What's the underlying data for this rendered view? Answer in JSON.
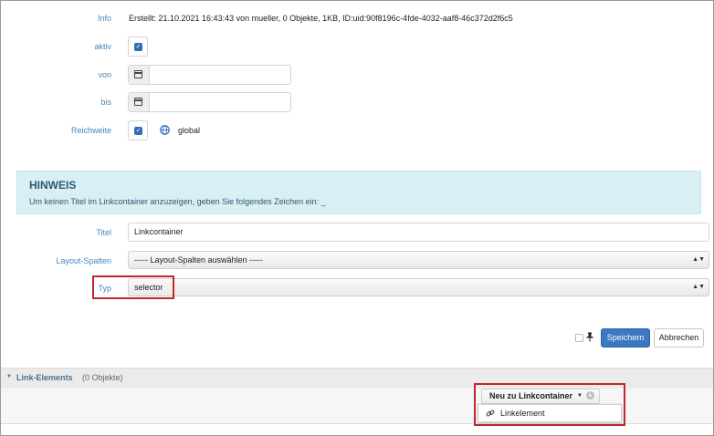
{
  "form": {
    "info_label": "Info",
    "info_value": "Erstellt: 21.10.2021 16:43:43 von mueller, 0 Objekte, 1KB, ID:uid:90f8196c-4fde-4032-aaf8-46c372d2f6c5",
    "aktiv_label": "aktiv",
    "aktiv_checked": true,
    "von_label": "von",
    "von_value": "",
    "bis_label": "bis",
    "bis_value": "",
    "reichweite_label": "Reichweite",
    "reichweite_checked": true,
    "reichweite_value": "global",
    "titel_label": "Titel",
    "titel_value": "Linkcontainer",
    "layout_label": "Layout-Spalten",
    "layout_value": "----- Layout-Spalten auswählen -----",
    "typ_label": "Typ",
    "typ_value": "selector"
  },
  "hint": {
    "heading": "HINWEIS",
    "text": "Um keinen Titel im Linkcontainer anzuzeigen, geben Sie folgendes Zeichen ein: _"
  },
  "actions": {
    "save_label": "Speichern",
    "cancel_label": "Abbrechen"
  },
  "links": {
    "section_label": "Link-Elements",
    "count": "(0 Objekte)",
    "new_button_label": "Neu zu Linkcontainer",
    "menu_item_label": "Linkelement"
  },
  "colors": {
    "label_blue": "#4a86b7",
    "primary_blue": "#3a78c2",
    "highlight_red": "#c0272d",
    "hint_bg": "#d9eff4"
  }
}
